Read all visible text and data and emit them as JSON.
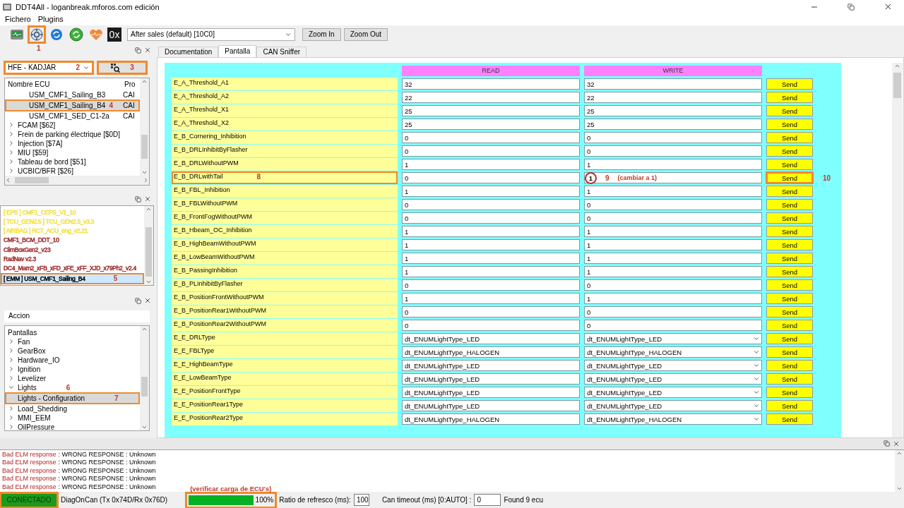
{
  "window": {
    "title": "DDT4All - loganbreak.mforos.com edición"
  },
  "menu": [
    "Fichero",
    "Plugins"
  ],
  "toolbar": {
    "icons": [
      {
        "kind": "ecu",
        "highlighted": false
      },
      {
        "kind": "scan",
        "highlighted": true,
        "callout": "1"
      },
      {
        "kind": "refresh",
        "highlighted": false
      },
      {
        "kind": "sync",
        "highlighted": false
      },
      {
        "kind": "heart",
        "highlighted": false
      },
      {
        "kind": "hex",
        "label": "0x",
        "highlighted": false
      }
    ],
    "session": "After sales (default) [10C0]",
    "buttons": [
      "Zoom In",
      "Zoom Out"
    ]
  },
  "vehicle": {
    "value": "HFE - KADJAR",
    "highlighted": true,
    "callout": "2"
  },
  "scan_button": {
    "highlighted": true,
    "callout": "3"
  },
  "ecu_tree": {
    "columns": [
      "Nombre ECU",
      "Pro"
    ],
    "items": [
      {
        "children": [
          {
            "label": "USM_CMF1_Sailing_B3",
            "protocol": "CAI",
            "selected": false,
            "highlighted": false
          },
          {
            "label": "USM_CMF1_Sailing_B4",
            "protocol": "CAI",
            "selected": true,
            "highlighted": true,
            "callout": "4"
          },
          {
            "label": "USM_CMF1_SED_C1-2a",
            "protocol": "CAI",
            "selected": false,
            "highlighted": false
          }
        ]
      },
      {
        "label": "FCAM [$62]",
        "expanded": false,
        "selected": false,
        "highlighted": false
      },
      {
        "label": "Frein de parking électrique [$0D]",
        "expanded": false,
        "selected": false,
        "highlighted": false
      },
      {
        "label": "Injection [$7A]",
        "expanded": false,
        "selected": false,
        "highlighted": false
      },
      {
        "label": "MIU [$59]",
        "expanded": false,
        "selected": false,
        "highlighted": false
      },
      {
        "label": "Tableau de bord [$51]",
        "expanded": false,
        "selected": false,
        "highlighted": false
      },
      {
        "label": "UCBIC/BFR [$26]",
        "expanded": false,
        "selected": false,
        "highlighted": false
      }
    ]
  },
  "ecu_list": [
    {
      "label": "[ EPS ] CMF1_CEPS_V1_10",
      "color": "#f0e040",
      "selected": false,
      "highlighted": false
    },
    {
      "label": "[ TCU_GEN2.5 ] TCU_GEN2.5_v3.3",
      "color": "#f0e040",
      "selected": false,
      "highlighted": false
    },
    {
      "label": "[ AIRBAG ] RC7_ACU_eng_v2.21",
      "color": "#f0e040",
      "selected": false,
      "highlighted": false
    },
    {
      "label": "CMF1_BCM_DDT_10",
      "color": "#a02828",
      "selected": false,
      "highlighted": false
    },
    {
      "label": "ClimBoxGen2_v23",
      "color": "#a02828",
      "selected": false,
      "highlighted": false
    },
    {
      "label": "RadNav v2.3",
      "color": "#a02828",
      "selected": false,
      "highlighted": false
    },
    {
      "label": "DC4_Mam2_xFB_xFD_xFE_xFF_XJD_x79Ph2_v2.4",
      "color": "#a02828",
      "selected": false,
      "highlighted": false
    },
    {
      "label": "[ EMM ] USM_CMF1_Sailing_B4",
      "color": "#000000",
      "selected": true,
      "highlighted": true,
      "callout": "5"
    }
  ],
  "action_field": "Accion",
  "screens": {
    "label": "Pantallas",
    "children": [
      {
        "label": "Fan",
        "expanded": false,
        "selected": false,
        "highlighted": false
      },
      {
        "label": "GearBox",
        "expanded": false,
        "selected": false,
        "highlighted": false
      },
      {
        "label": "Hardware_IO",
        "expanded": false,
        "selected": false,
        "highlighted": false
      },
      {
        "label": "Ignition",
        "expanded": false,
        "selected": false,
        "highlighted": false
      },
      {
        "label": "Levelizer",
        "expanded": false,
        "selected": false,
        "highlighted": false
      },
      {
        "label": "Lights",
        "expanded": true,
        "selected": false,
        "highlighted": false,
        "callout": "6",
        "children": [
          {
            "label": "Lights - Configuration",
            "selected": true,
            "highlighted": true,
            "callout": "7"
          }
        ]
      },
      {
        "label": "Load_Shedding",
        "expanded": false,
        "selected": false,
        "highlighted": false
      },
      {
        "label": "MMI_EEM",
        "expanded": false,
        "selected": false,
        "highlighted": false
      },
      {
        "label": "OilPressure",
        "expanded": false,
        "selected": false,
        "highlighted": false
      }
    ]
  },
  "tabs": [
    {
      "label": "Documentation",
      "selected": false
    },
    {
      "label": "Pantalla",
      "selected": true
    },
    {
      "label": "CAN Sniffer",
      "selected": false
    }
  ],
  "table": {
    "columns": [
      "READ",
      "WRITE"
    ],
    "rows": [
      {
        "name": "E_A_Threshold_A1",
        "kind": "value",
        "read": "32",
        "write": "32",
        "send": "Send",
        "highlighted": false,
        "write_circled": false,
        "send_highlighted": false
      },
      {
        "name": "E_A_Threshold_A2",
        "kind": "value",
        "read": "22",
        "write": "22",
        "send": "Send",
        "highlighted": false,
        "write_circled": false,
        "send_highlighted": false
      },
      {
        "name": "E_A_Threshold_X1",
        "kind": "value",
        "read": "25",
        "write": "25",
        "send": "Send",
        "highlighted": false,
        "write_circled": false,
        "send_highlighted": false
      },
      {
        "name": "E_A_Threshold_X2",
        "kind": "value",
        "read": "25",
        "write": "25",
        "send": "Send",
        "highlighted": false,
        "write_circled": false,
        "send_highlighted": false
      },
      {
        "name": "E_B_Cornering_Inhibition",
        "kind": "value",
        "read": "0",
        "write": "0",
        "send": "Send",
        "highlighted": false,
        "write_circled": false,
        "send_highlighted": false
      },
      {
        "name": "E_B_DRLInhibitByFlasher",
        "kind": "value",
        "read": "0",
        "write": "0",
        "send": "Send",
        "highlighted": false,
        "write_circled": false,
        "send_highlighted": false
      },
      {
        "name": "E_B_DRLWithoutPWM",
        "kind": "value",
        "read": "1",
        "write": "1",
        "send": "Send",
        "highlighted": false,
        "write_circled": false,
        "send_highlighted": false
      },
      {
        "name": "E_B_DRLwithTail",
        "kind": "value",
        "read": "0",
        "write": "1",
        "send": "Send",
        "highlighted": true,
        "callout": "8",
        "write_circled": true,
        "write_callout": "9",
        "note": "(cambiar a 1)",
        "send_highlighted": true,
        "send_callout": "10"
      },
      {
        "name": "E_B_FBL_Inhibition",
        "kind": "value",
        "read": "1",
        "write": "1",
        "send": "Send",
        "highlighted": false,
        "write_circled": false,
        "send_highlighted": false
      },
      {
        "name": "E_B_FBLWithoutPWM",
        "kind": "value",
        "read": "0",
        "write": "0",
        "send": "Send",
        "highlighted": false,
        "write_circled": false,
        "send_highlighted": false
      },
      {
        "name": "E_B_FrontFogWithoutPWM",
        "kind": "value",
        "read": "0",
        "write": "0",
        "send": "Send",
        "highlighted": false,
        "write_circled": false,
        "send_highlighted": false
      },
      {
        "name": "E_B_Hbeam_OC_Inhibition",
        "kind": "value",
        "read": "1",
        "write": "1",
        "send": "Send",
        "highlighted": false,
        "write_circled": false,
        "send_highlighted": false
      },
      {
        "name": "E_B_HighBeamWithoutPWM",
        "kind": "value",
        "read": "1",
        "write": "1",
        "send": "Send",
        "highlighted": false,
        "write_circled": false,
        "send_highlighted": false
      },
      {
        "name": "E_B_LowBeamWithoutPWM",
        "kind": "value",
        "read": "1",
        "write": "1",
        "send": "Send",
        "highlighted": false,
        "write_circled": false,
        "send_highlighted": false
      },
      {
        "name": "E_B_PassingInhibition",
        "kind": "value",
        "read": "1",
        "write": "1",
        "send": "Send",
        "highlighted": false,
        "write_circled": false,
        "send_highlighted": false
      },
      {
        "name": "E_B_PLInhibitByFlasher",
        "kind": "value",
        "read": "0",
        "write": "0",
        "send": "Send",
        "highlighted": false,
        "write_circled": false,
        "send_highlighted": false
      },
      {
        "name": "E_B_PositionFrontWithoutPWM",
        "kind": "value",
        "read": "1",
        "write": "1",
        "send": "Send",
        "highlighted": false,
        "write_circled": false,
        "send_highlighted": false
      },
      {
        "name": "E_B_PositionRear1WithoutPWM",
        "kind": "value",
        "read": "0",
        "write": "0",
        "send": "Send",
        "highlighted": false,
        "write_circled": false,
        "send_highlighted": false
      },
      {
        "name": "E_B_PositionRear2WithoutPWM",
        "kind": "value",
        "read": "0",
        "write": "0",
        "send": "Send",
        "highlighted": false,
        "write_circled": false,
        "send_highlighted": false
      },
      {
        "name": "E_E_DRLType",
        "kind": "enum",
        "read": "dt_ENUMLightType_LED",
        "write": "dt_ENUMLightType_LED",
        "send": "Send",
        "highlighted": false,
        "write_circled": false,
        "send_highlighted": false
      },
      {
        "name": "E_E_FBLType",
        "kind": "enum",
        "read": "dt_ENUMLightType_HALOGEN",
        "write": "dt_ENUMLightType_HALOGEN",
        "send": "Send",
        "highlighted": false,
        "write_circled": false,
        "send_highlighted": false
      },
      {
        "name": "E_E_HighBeamType",
        "kind": "enum",
        "read": "dt_ENUMLightType_LED",
        "write": "dt_ENUMLightType_LED",
        "send": "Send",
        "highlighted": false,
        "write_circled": false,
        "send_highlighted": false
      },
      {
        "name": "E_E_LowBeamType",
        "kind": "enum",
        "read": "dt_ENUMLightType_LED",
        "write": "dt_ENUMLightType_LED",
        "send": "Send",
        "highlighted": false,
        "write_circled": false,
        "send_highlighted": false
      },
      {
        "name": "E_E_PositionFrontType",
        "kind": "enum",
        "read": "dt_ENUMLightType_LED",
        "write": "dt_ENUMLightType_LED",
        "send": "Send",
        "highlighted": false,
        "write_circled": false,
        "send_highlighted": false
      },
      {
        "name": "E_E_PositionRear1Type",
        "kind": "enum",
        "read": "dt_ENUMLightType_LED",
        "write": "dt_ENUMLightType_LED",
        "send": "Send",
        "highlighted": false,
        "write_circled": false,
        "send_highlighted": false
      },
      {
        "name": "E_E_PositionRear2Type",
        "kind": "enum",
        "read": "dt_ENUMLightType_HALOGEN",
        "write": "dt_ENUMLightType_HALOGEN",
        "send": "Send",
        "highlighted": false,
        "write_circled": false,
        "send_highlighted": false
      }
    ]
  },
  "log": [
    {
      "source": "Bad ELM response",
      "message": ": WRONG RESPONSE : Unknown"
    },
    {
      "source": "Bad ELM response",
      "message": ": WRONG RESPONSE : Unknown"
    },
    {
      "source": "Bad ELM response",
      "message": ": WRONG RESPONSE : Unknown"
    },
    {
      "source": "Bad ELM response",
      "message": ": WRONG RESPONSE : Unknown"
    },
    {
      "source": "Bad ELM response",
      "message": ": WRONG RESPONSE : Unknown"
    }
  ],
  "status_bar": {
    "connection": {
      "label": "CONECTADO",
      "connected": true,
      "highlighted": true
    },
    "adapter": "DiagOnCan (Tx 0x74D/Rx 0x76D)",
    "progress": {
      "level": 1,
      "reading": "100%",
      "highlighted": true,
      "note": "(verificar carga de ECU's)"
    },
    "refresh_label": "Ratio de refresco (ms):",
    "refresh_value": "100",
    "timeout_label": "Can timeout (ms) [0:AUTO] :",
    "timeout_value": "0",
    "found": "Found 9 ecu"
  }
}
